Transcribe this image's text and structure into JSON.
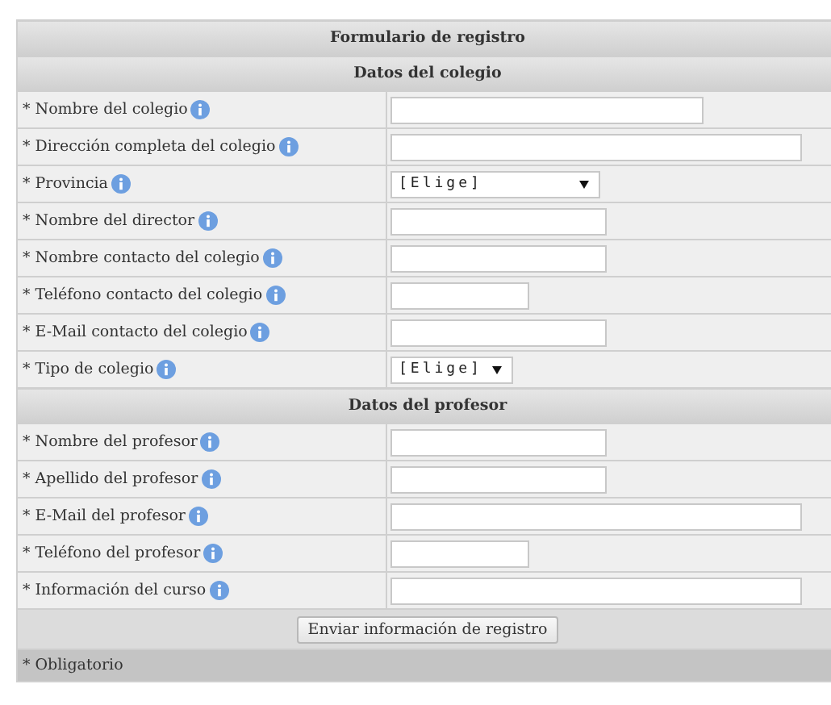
{
  "form": {
    "title": "Formulario de registro",
    "sections": [
      {
        "title": "Datos del colegio",
        "fields": [
          {
            "label": "* Nombre del colegio",
            "kind": "text"
          },
          {
            "label": "* Dirección completa del colegio",
            "kind": "text"
          },
          {
            "label": "* Provincia",
            "kind": "select",
            "value": "[Elige]"
          },
          {
            "label": "* Nombre del director",
            "kind": "text"
          },
          {
            "label": "* Nombre contacto del colegio",
            "kind": "text"
          },
          {
            "label": "* Teléfono contacto del colegio",
            "kind": "text"
          },
          {
            "label": "* E-Mail contacto del colegio",
            "kind": "text"
          },
          {
            "label": "* Tipo de colegio",
            "kind": "select",
            "value": "[Elige]"
          }
        ]
      },
      {
        "title": "Datos del profesor",
        "fields": [
          {
            "label": "* Nombre del profesor",
            "kind": "text"
          },
          {
            "label": "* Apellido del profesor",
            "kind": "text"
          },
          {
            "label": "* E-Mail del profesor",
            "kind": "text"
          },
          {
            "label": "* Teléfono del profesor",
            "kind": "text"
          },
          {
            "label": "* Información del curso",
            "kind": "text"
          }
        ]
      }
    ],
    "submit": "Enviar información de registro",
    "footnote": "* Obligatorio"
  }
}
